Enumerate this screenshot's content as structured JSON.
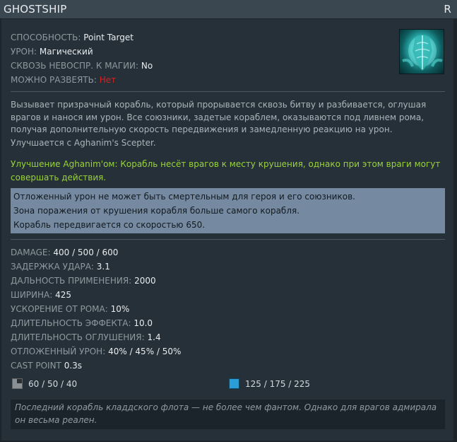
{
  "ability": {
    "title": "GHOSTSHIP",
    "hotkey": "R"
  },
  "properties": [
    {
      "label": "СПОСОБНОСТЬ:",
      "value": "Point Target"
    },
    {
      "label": "УРОН:",
      "value": "Магический"
    },
    {
      "label": "СКВОЗЬ НЕВОСПР. К МАГИИ:",
      "value": "No"
    },
    {
      "label": "МОЖНО РАЗВЕЯТЬ:",
      "value": "Нет"
    }
  ],
  "icon": "ghostship-ability-icon",
  "description": {
    "text": "Вызывает призрачный корабль, который прорывается сквозь битву и разбивается, оглушая врагов и нанося им урон. Все союзники, задетые кораблем, оказываются под ливнем рома, получая дополнительную скорость передвижения и замедленную реакцию на урон.",
    "upgrade_note": "Улучшается с Aghanim's Scepter."
  },
  "scepter_text": "Улучшение Aghanim'ом: Корабль несёт врагов к месту крушения, однако при этом враги могут совершать действия.",
  "notes": [
    "Отложенный урон не может быть смертельным для героя и его союзников.",
    "Зона поражения от крушения корабля больше самого корабля.",
    "Корабль передвигается со скоростью 650."
  ],
  "stats": [
    {
      "label": "DAMAGE:",
      "value": "400 / 500 / 600"
    },
    {
      "label": "ЗАДЕРЖКА УДАРА:",
      "value": "3.1"
    },
    {
      "label": "ДАЛЬНОСТЬ ПРИМЕНЕНИЯ:",
      "value": "2000"
    },
    {
      "label": "ШИРИНА:",
      "value": "425"
    },
    {
      "label": "УСКОРЕНИЕ ОТ РОМА:",
      "value": "10%"
    },
    {
      "label": "ДЛИТЕЛЬНОСТЬ ЭФФЕКТА:",
      "value": "10.0"
    },
    {
      "label": "ДЛИТЕЛЬНОСТЬ ОГЛУШЕНИЯ:",
      "value": "1.4"
    },
    {
      "label": "ОТЛОЖЕННЫЙ УРОН:",
      "value": "40% / 45% / 50%"
    },
    {
      "label": "CAST POINT",
      "value": "0.3s"
    }
  ],
  "cooldown": {
    "icon": "cooldown-icon",
    "value": "60 / 50 / 40"
  },
  "mana": {
    "icon": "mana-icon",
    "value": "125 / 175 / 225"
  },
  "lore": "Последний корабль кладдского флота — не более чем фантом. Однако для врагов адмирала он весьма реален.",
  "colors": {
    "scepter": "#9ad33b",
    "dispel_no": "#d52222",
    "notes_bg": "#7589a0",
    "title_bar": "#3a4750"
  }
}
